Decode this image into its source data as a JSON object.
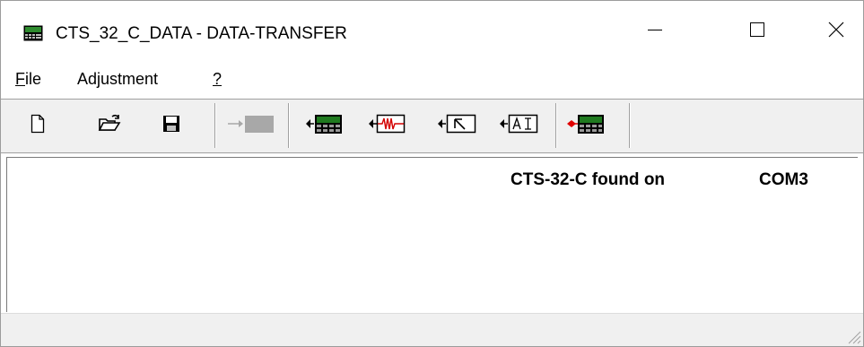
{
  "window": {
    "title": "CTS_32_C_DATA - DATA-TRANSFER",
    "icon": "device-terminal-icon",
    "controls": {
      "minimize": "minimize-icon",
      "maximize": "maximize-icon",
      "close": "close-icon"
    }
  },
  "menu": {
    "file_rest": "ile",
    "file_first": "F",
    "adjustment": "Adjustment",
    "help": "?"
  },
  "toolbar": {
    "buttons": [
      {
        "icon": "new-document-icon",
        "enabled": true
      },
      {
        "icon": "open-folder-icon",
        "enabled": true
      },
      {
        "icon": "save-disk-icon",
        "enabled": true
      },
      {
        "icon": "send-to-device-icon",
        "enabled": false
      },
      {
        "icon": "read-device-data-icon",
        "enabled": true
      },
      {
        "icon": "read-waveform-icon",
        "enabled": true
      },
      {
        "icon": "read-cursor-icon",
        "enabled": true
      },
      {
        "icon": "read-ai-icon",
        "enabled": true
      },
      {
        "icon": "device-connect-icon",
        "enabled": true
      }
    ]
  },
  "content": {
    "found_text": "CTS-32-C found on",
    "port": "COM3"
  },
  "colors": {
    "device_green": "#1f7a1f",
    "device_dark": "#000000",
    "waveform_red": "#d40000",
    "connect_red": "#e00000",
    "disabled_gray": "#a8a8a8"
  }
}
